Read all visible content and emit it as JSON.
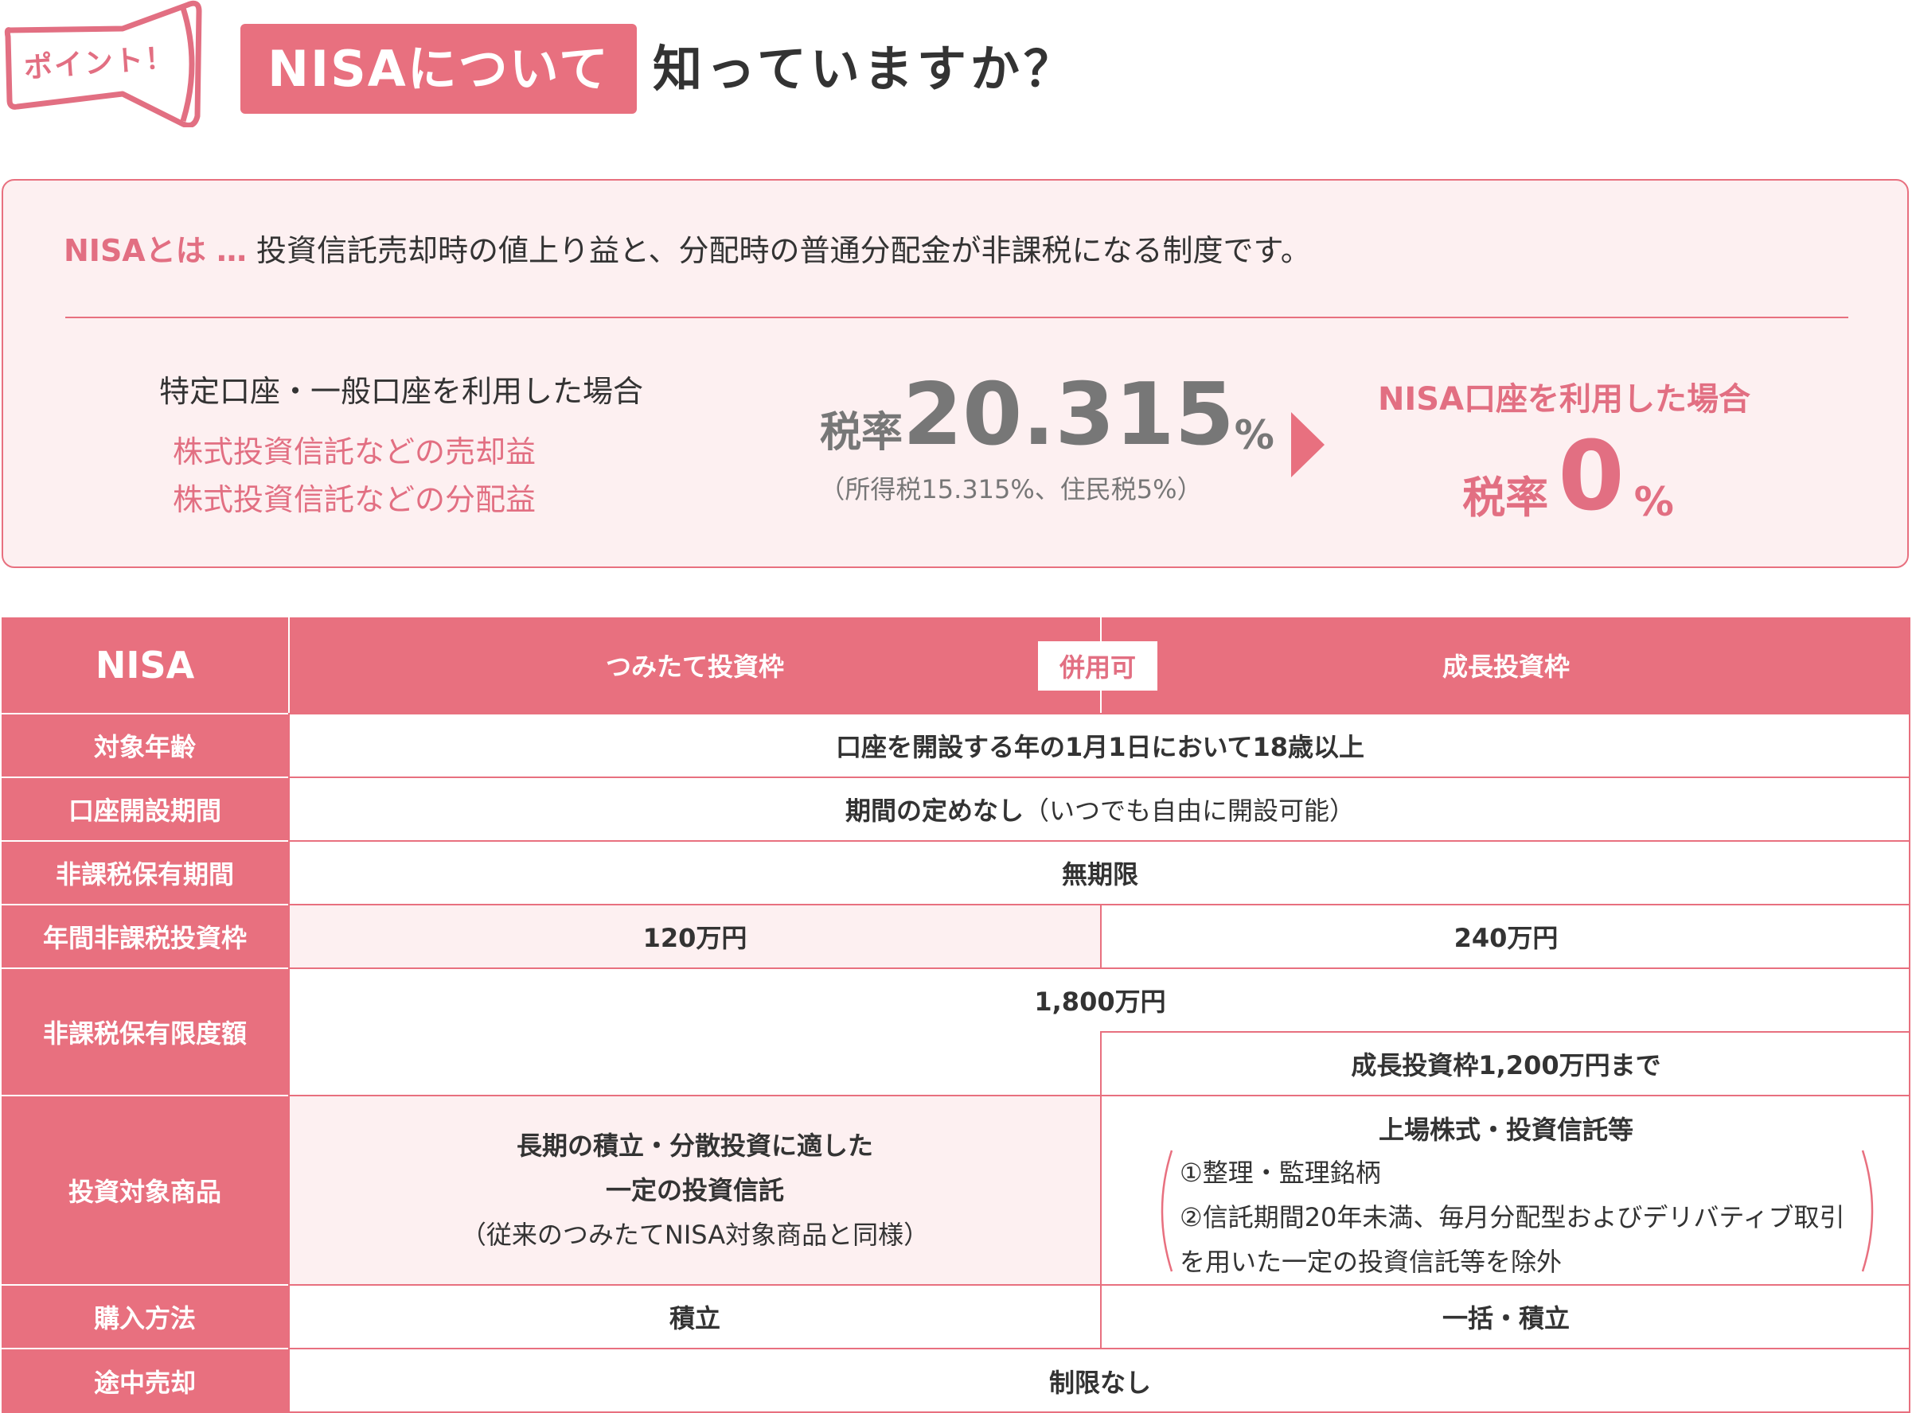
{
  "header": {
    "badge": "ポイント！",
    "title_highlight": "NISAについて",
    "title_rest": "知っていますか？"
  },
  "info": {
    "definition_label": "NISAとは …",
    "definition_text": " 投資信託売却時の値上り益と、分配時の普通分配金が非課税になる制度です。",
    "normal_case": "特定口座・一般口座を利用した場合",
    "gains": [
      "株式投資信託などの売却益",
      "株式投資信託などの分配益"
    ],
    "normal_rate_label": "税率",
    "normal_rate_value": "20.315",
    "normal_rate_unit": "%",
    "normal_rate_detail": "（所得税15.315%、住民税5%）",
    "nisa_case": "NISA口座を利用した場合",
    "nisa_rate_label": "税率",
    "nisa_rate_value": "0",
    "nisa_rate_unit": "%"
  },
  "table": {
    "header": {
      "label": "NISA",
      "col_a": "つみたて投資枠",
      "combo": "併用可",
      "col_b": "成長投資枠"
    },
    "rows": {
      "age": {
        "label": "対象年齢",
        "value": "口座を開設する年の1月1日において18歳以上"
      },
      "period": {
        "label": "口座開設期間",
        "value_bold": "期間の定めなし",
        "value_note": "（いつでも自由に開設可能）"
      },
      "holding": {
        "label": "非課税保有期間",
        "value": "無期限"
      },
      "annual": {
        "label": "年間非課税投資枠",
        "col_a": "120万円",
        "col_b": "240万円"
      },
      "limit": {
        "label": "非課税保有限度額",
        "total": "1,800万円",
        "col_b": "成長投資枠1,200万円まで"
      },
      "products": {
        "label": "投資対象商品",
        "col_a_line1": "長期の積立・分散投資に適した",
        "col_a_line2": "一定の投資信託",
        "col_a_note": "（従来のつみたてNISA対象商品と同様）",
        "col_b_title": "上場株式・投資信託等",
        "col_b_items": [
          "①整理・監理銘柄",
          "②信託期間20年未満、毎月分配型およびデリバティブ取引",
          "を用いた一定の投資信託等を除外"
        ]
      },
      "purchase": {
        "label": "購入方法",
        "col_a": "積立",
        "col_b": "一括・積立"
      },
      "sale": {
        "label": "途中売却",
        "value": "制限なし"
      }
    }
  },
  "colors": {
    "accent": "#e8707f",
    "accent_text": "#e26f82",
    "pale": "#fdf0f1",
    "gray": "#777777"
  }
}
